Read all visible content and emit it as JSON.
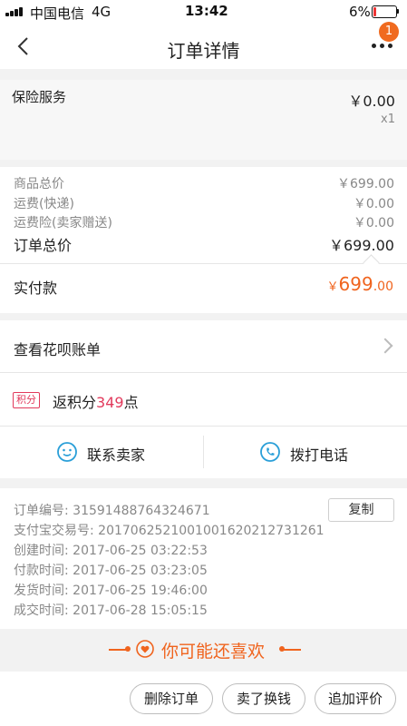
{
  "status_bar": {
    "carrier": "中国电信",
    "network": "4G",
    "time": "13:42",
    "battery": "6%"
  },
  "nav": {
    "title": "订单详情",
    "badge_count": "1"
  },
  "insurance": {
    "name": "保险服务",
    "price": "￥0.00",
    "quantity": "x1"
  },
  "summary": {
    "rows": [
      {
        "label": "商品总价",
        "value": "￥699.00"
      },
      {
        "label": "运费(快递)",
        "value": "￥0.00"
      },
      {
        "label": "运费险(卖家赠送)",
        "value": "￥0.00"
      }
    ],
    "total_label": "订单总价",
    "total_value": "￥699.00"
  },
  "actual_payment": {
    "label": "实付款",
    "currency": "￥",
    "integer": "699",
    "decimal": ".00"
  },
  "huabei": {
    "label": "查看花呗账单"
  },
  "points": {
    "tag": "积分",
    "prefix": "返积分",
    "value": "349",
    "suffix": "点"
  },
  "contact": {
    "seller_label": "联系卖家",
    "call_label": "拨打电话"
  },
  "order_info": {
    "copy_label": "复制",
    "rows": [
      {
        "label": "订单编号:",
        "value": "3159148876432467​1"
      },
      {
        "label": "支付宝交易号:",
        "value": "2017062521001001620212731261"
      },
      {
        "label": "创建时间:",
        "value": "2017-06-25 03:22:53"
      },
      {
        "label": "付款时间:",
        "value": "2017-06-25 03:23:05"
      },
      {
        "label": "发货时间:",
        "value": "2017-06-25 19:46:00"
      },
      {
        "label": "成交时间:",
        "value": "2017-06-28 15:05:15"
      }
    ]
  },
  "recommend": {
    "title": "你可能还喜欢"
  },
  "bottom_actions": {
    "delete_label": "删除订单",
    "resell_label": "卖了换钱",
    "review_label": "追加评价"
  },
  "colors": {
    "accent": "#f0641e",
    "points": "#e23a5c",
    "contact_icon": "#2a9fd8"
  },
  "icons": [
    "back-icon",
    "more-icon",
    "chevron-right-icon",
    "chat-icon",
    "phone-icon",
    "heart-icon"
  ]
}
